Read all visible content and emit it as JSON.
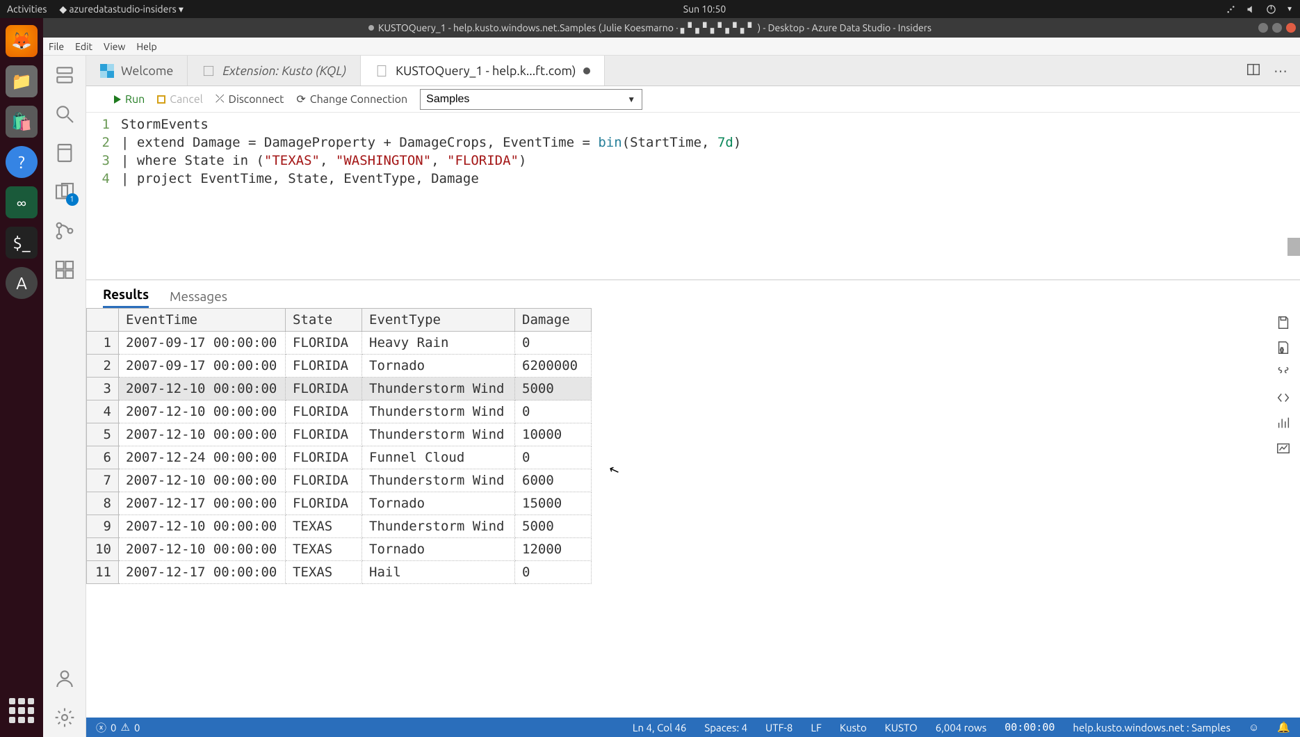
{
  "gnome": {
    "activities": "Activities",
    "app_menu": "azuredatastudio-insiders",
    "clock": "Sun 10:50"
  },
  "window": {
    "title": "KUSTOQuery_1 - help.kusto.windows.net.Samples (Julie Koesmarno  ·  ▖▘▖▘▖▘▖▘▖▘ ) - Desktop - Azure Data Studio - Insiders"
  },
  "menubar": [
    "File",
    "Edit",
    "View",
    "Help"
  ],
  "tabs": [
    {
      "label": "Welcome"
    },
    {
      "label": "Extension: Kusto (KQL)"
    },
    {
      "label": "KUSTOQuery_1 - help.k...ft.com)"
    }
  ],
  "qtoolbar": {
    "run": "Run",
    "cancel": "Cancel",
    "disconnect": "Disconnect",
    "change_conn": "Change Connection",
    "db": "Samples"
  },
  "editor_lines": [
    {
      "n": "1",
      "plain": "StormEvents"
    },
    {
      "n": "2",
      "plain": "| extend Damage = DamageProperty + DamageCrops, EventTime = bin(StartTime, 7d)"
    },
    {
      "n": "3",
      "plain": "| where State in (\"TEXAS\", \"WASHINGTON\", \"FLORIDA\")"
    },
    {
      "n": "4",
      "plain": "| project EventTime, State, EventType, Damage"
    }
  ],
  "result_tabs": {
    "results": "Results",
    "messages": "Messages"
  },
  "grid": {
    "columns": [
      "EventTime",
      "State",
      "EventType",
      "Damage"
    ],
    "rows": [
      [
        "2007-09-17 00:00:00",
        "FLORIDA",
        "Heavy Rain",
        "0"
      ],
      [
        "2007-09-17 00:00:00",
        "FLORIDA",
        "Tornado",
        "6200000"
      ],
      [
        "2007-12-10 00:00:00",
        "FLORIDA",
        "Thunderstorm Wind",
        "5000"
      ],
      [
        "2007-12-10 00:00:00",
        "FLORIDA",
        "Thunderstorm Wind",
        "0"
      ],
      [
        "2007-12-10 00:00:00",
        "FLORIDA",
        "Thunderstorm Wind",
        "10000"
      ],
      [
        "2007-12-24 00:00:00",
        "FLORIDA",
        "Funnel Cloud",
        "0"
      ],
      [
        "2007-12-10 00:00:00",
        "FLORIDA",
        "Thunderstorm Wind",
        "6000"
      ],
      [
        "2007-12-17 00:00:00",
        "FLORIDA",
        "Tornado",
        "15000"
      ],
      [
        "2007-12-10 00:00:00",
        "TEXAS",
        "Thunderstorm Wind",
        "5000"
      ],
      [
        "2007-12-10 00:00:00",
        "TEXAS",
        "Tornado",
        "12000"
      ],
      [
        "2007-12-17 00:00:00",
        "TEXAS",
        "Hail",
        "0"
      ]
    ],
    "selected_row_index": 2
  },
  "status": {
    "errors": "0",
    "warnings": "0",
    "cursor": "Ln 4, Col 46",
    "spaces": "Spaces: 4",
    "encoding": "UTF-8",
    "eol": "LF",
    "lang": "Kusto",
    "mode": "KUSTO",
    "rows": "6,004 rows",
    "time": "00:00:00",
    "conn": "help.kusto.windows.net : Samples"
  },
  "scm_badge": "1"
}
